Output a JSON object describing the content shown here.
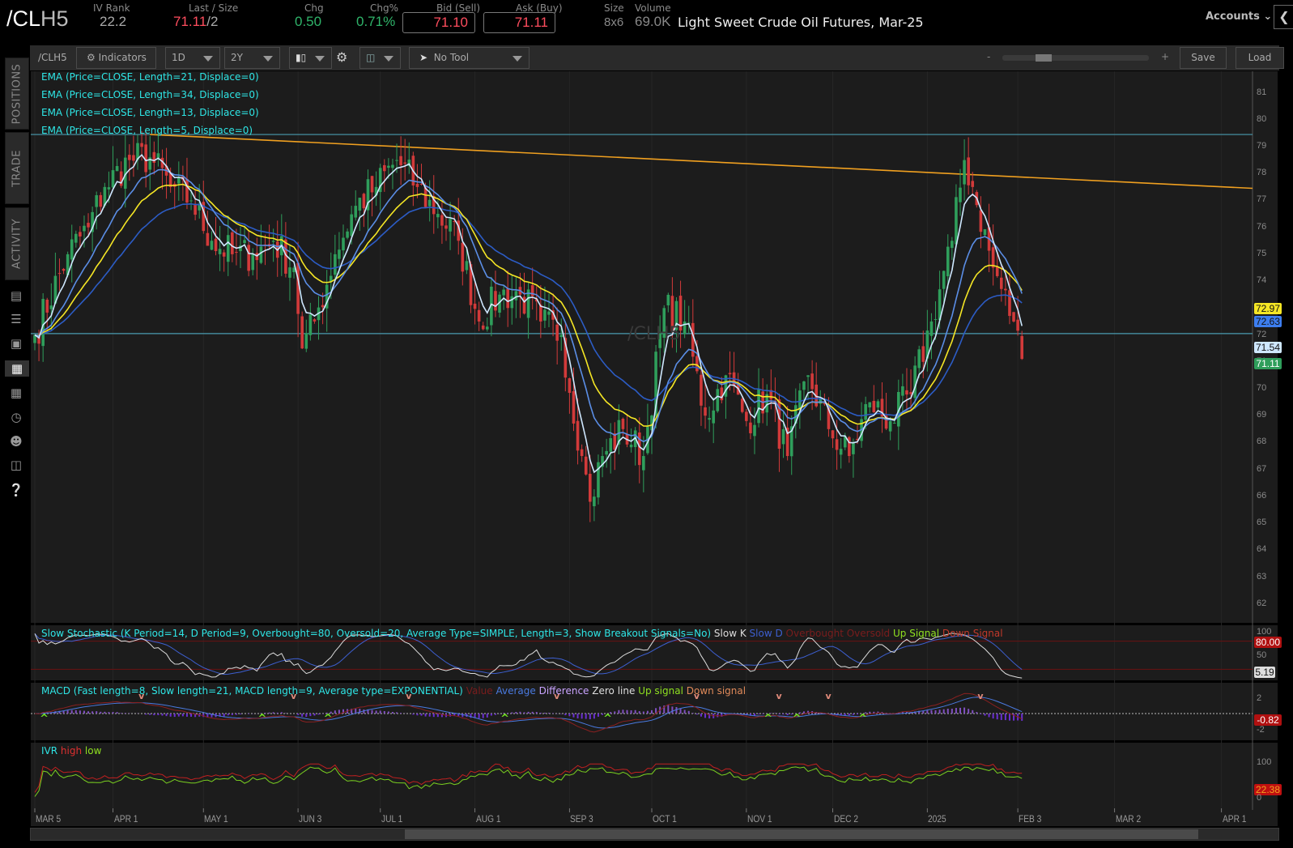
{
  "header": {
    "symbol_prefix": "/CL",
    "symbol_suffix": "H5",
    "iv_rank_label": "IV Rank",
    "iv_rank": "22.2",
    "last_size_label": "Last / Size",
    "last": "71.11",
    "size_sep": "/2",
    "chg_label": "Chg",
    "chg": "0.50",
    "chgpct_label": "Chg%",
    "chgpct": "0.71%",
    "bid_label": "Bid (Sell)",
    "bid": "71.10",
    "ask_label": "Ask (Buy)",
    "ask": "71.11",
    "size_label": "Size",
    "size": "8x6",
    "volume_label": "Volume",
    "volume": "69.0K",
    "description": "Light Sweet Crude Oil Futures, Mar-25",
    "accounts": "Accounts"
  },
  "sidebar": {
    "tabs": [
      "POSITIONS",
      "TRADE",
      "ACTIVITY"
    ],
    "icons": [
      "report-icon",
      "list-icon",
      "tv-icon",
      "chart-icon",
      "grid-icon",
      "dial-icon",
      "people-icon",
      "calendar-icon",
      "help-icon"
    ]
  },
  "toolbar": {
    "symbol": "/CLH5",
    "indicators": "Indicators",
    "aggregation": "1D",
    "timeframe": "2Y",
    "tool": "No Tool",
    "zoom_out": "-",
    "zoom_in": "+",
    "zoom_level": 0.45,
    "save": "Save",
    "load": "Load"
  },
  "studies": [
    "EMA (Price=CLOSE, Length=21, Displace=0)",
    "EMA (Price=CLOSE, Length=34, Displace=0)",
    "EMA (Price=CLOSE, Length=13, Displace=0)",
    "EMA (Price=CLOSE, Length=5, Displace=0)"
  ],
  "watermark": "/CLH5",
  "stoch": {
    "title": "Slow Stochastic (K Period=14, D Period=9, Overbought=80, Oversold=20, Average Type=SIMPLE, Length=3, Show Breakout Signals=No)",
    "legend": [
      "Slow K",
      "Slow D",
      "Overbought",
      "Oversold",
      "Up Signal",
      "Down Signal"
    ],
    "axis": [
      "100",
      "50"
    ],
    "badges": [
      "80.00",
      "5.19"
    ]
  },
  "macd": {
    "title": "MACD (Fast length=8, Slow length=21, MACD length=9, Average type=EXPONENTIAL)",
    "legend": [
      "Value",
      "Average",
      "Difference",
      "Zero line",
      "Up signal",
      "Down signal"
    ],
    "axis": [
      "2",
      "-2"
    ],
    "badges": [
      "-0.82"
    ]
  },
  "ivr": {
    "title": "IVR",
    "legend": [
      "high",
      "low"
    ],
    "axis": [
      "100",
      "0"
    ],
    "badges": [
      "22.38"
    ]
  },
  "colors": {
    "up": "#2f9e5b",
    "down": "#d23a3a",
    "ema21": "#f5e625",
    "ema34": "#2c5cc5",
    "ema13": "#5b8ee6",
    "ema5": "#cfe8ff",
    "trend": "#f0a020",
    "hline": "#4a9cb0"
  },
  "chart_data": {
    "type": "candlestick",
    "ylim": [
      61.3,
      81.8
    ],
    "yticks": [
      62,
      63,
      64,
      65,
      66,
      67,
      68,
      69,
      70,
      71,
      72,
      73,
      74,
      75,
      76,
      77,
      78,
      79,
      80,
      81
    ],
    "price_badges": [
      {
        "value": "72.97",
        "color": "#f5e625"
      },
      {
        "value": "72.63",
        "color": "#3d7ef0"
      },
      {
        "value": "71.54",
        "color": "#cfe8ff"
      },
      {
        "value": "71.11",
        "color": "#2f9e5b"
      }
    ],
    "xticks": [
      {
        "label": "MAR 5",
        "date": "2024-03-05"
      },
      {
        "label": "APR 1",
        "date": "2024-04-01"
      },
      {
        "label": "MAY 1",
        "date": "2024-05-01"
      },
      {
        "label": "JUN 3",
        "date": "2024-06-03"
      },
      {
        "label": "JUL 1",
        "date": "2024-07-01"
      },
      {
        "label": "AUG 1",
        "date": "2024-08-01"
      },
      {
        "label": "SEP 3",
        "date": "2024-09-03"
      },
      {
        "label": "OCT 1",
        "date": "2024-10-01"
      },
      {
        "label": "NOV 1",
        "date": "2024-11-01"
      },
      {
        "label": "DEC 2",
        "date": "2024-12-02"
      },
      {
        "label": "2025",
        "date": "2025-01-02"
      },
      {
        "label": "FEB 3",
        "date": "2025-02-03"
      },
      {
        "label": "MAR 2",
        "date": "2025-03-02"
      },
      {
        "label": "APR 1",
        "date": "2025-04-01"
      }
    ],
    "closes": [
      [
        "2024-03-05",
        72.0
      ],
      [
        "2024-03-15",
        75.0
      ],
      [
        "2024-03-22",
        76.0
      ],
      [
        "2024-03-28",
        77.5
      ],
      [
        "2024-04-05",
        78.5
      ],
      [
        "2024-04-12",
        78.6
      ],
      [
        "2024-04-19",
        77.5
      ],
      [
        "2024-04-26",
        77.0
      ],
      [
        "2024-05-03",
        75.5
      ],
      [
        "2024-05-10",
        75.0
      ],
      [
        "2024-05-17",
        75.0
      ],
      [
        "2024-05-24",
        75.5
      ],
      [
        "2024-05-31",
        74.5
      ],
      [
        "2024-06-04",
        71.5
      ],
      [
        "2024-06-07",
        72.5
      ],
      [
        "2024-06-14",
        75.0
      ],
      [
        "2024-06-21",
        76.8
      ],
      [
        "2024-06-28",
        77.5
      ],
      [
        "2024-07-05",
        78.5
      ],
      [
        "2024-07-12",
        77.5
      ],
      [
        "2024-07-19",
        76.5
      ],
      [
        "2024-07-26",
        75.5
      ],
      [
        "2024-08-02",
        72.5
      ],
      [
        "2024-08-09",
        73.5
      ],
      [
        "2024-08-16",
        73.5
      ],
      [
        "2024-08-23",
        72.5
      ],
      [
        "2024-08-30",
        72.0
      ],
      [
        "2024-09-06",
        67.5
      ],
      [
        "2024-09-10",
        65.8
      ],
      [
        "2024-09-13",
        67.5
      ],
      [
        "2024-09-20",
        68.5
      ],
      [
        "2024-09-27",
        67.5
      ],
      [
        "2024-10-04",
        73.0
      ],
      [
        "2024-10-11",
        72.5
      ],
      [
        "2024-10-18",
        69.0
      ],
      [
        "2024-10-25",
        70.5
      ],
      [
        "2024-11-01",
        68.8
      ],
      [
        "2024-11-08",
        69.8
      ],
      [
        "2024-11-15",
        67.5
      ],
      [
        "2024-11-22",
        70.5
      ],
      [
        "2024-11-29",
        68.5
      ],
      [
        "2024-12-06",
        67.5
      ],
      [
        "2024-12-13",
        69.5
      ],
      [
        "2024-12-20",
        68.8
      ],
      [
        "2024-12-27",
        69.8
      ],
      [
        "2025-01-03",
        72.5
      ],
      [
        "2025-01-10",
        75.5
      ],
      [
        "2025-01-15",
        78.5
      ],
      [
        "2025-01-17",
        77.5
      ],
      [
        "2025-01-24",
        74.5
      ],
      [
        "2025-01-31",
        72.5
      ],
      [
        "2025-02-04",
        71.11
      ]
    ],
    "horizontal_lines": [
      79.45,
      72.05
    ],
    "trendline": [
      [
        "2024-04-12",
        79.45
      ],
      [
        "2025-04-01",
        77.45
      ]
    ]
  }
}
